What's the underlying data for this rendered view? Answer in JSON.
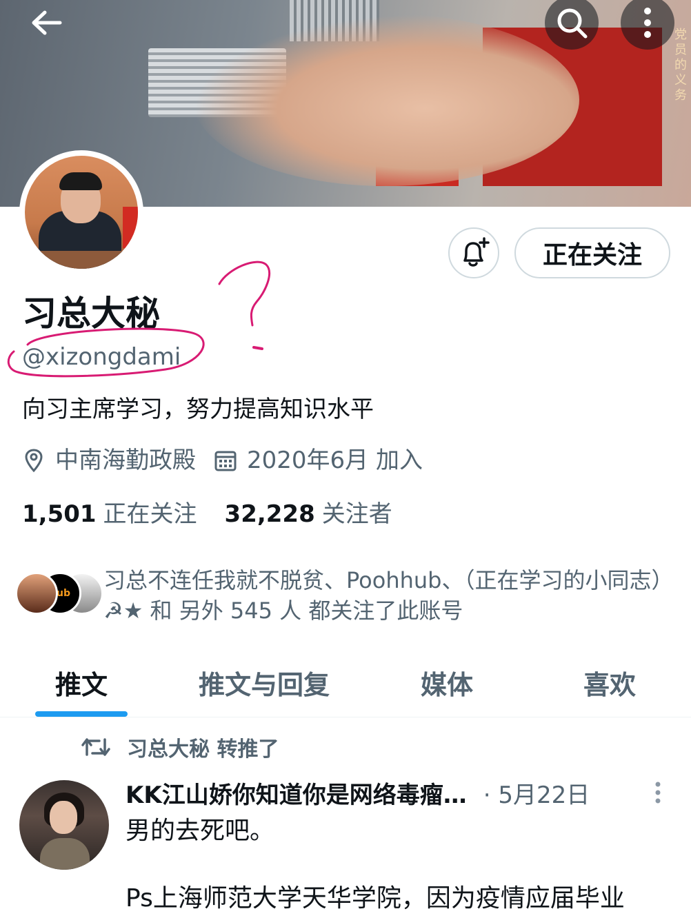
{
  "banner": {
    "side_text": "党员的义务"
  },
  "profile": {
    "display_name": "习总大秘",
    "handle": "@xizongdami",
    "bio": "向习主席学习，努力提高知识水平",
    "location": "中南海勤政殿",
    "joined": "2020年6月 加入",
    "following_count": "1,501",
    "following_label": "正在关注",
    "followers_count": "32,228",
    "followers_label": "关注者"
  },
  "actions": {
    "follow_label": "正在关注"
  },
  "followed_by": {
    "text": "习总不连任我就不脱贫、Poohhub、（正在学习的小同志）☭★ 和 另外 545 人 都关注了此账号",
    "badge": "hub"
  },
  "tabs": [
    {
      "label": "推文",
      "active": true
    },
    {
      "label": "推文与回复",
      "active": false
    },
    {
      "label": "媒体",
      "active": false
    },
    {
      "label": "喜欢",
      "active": false
    }
  ],
  "tweet": {
    "retweeted_by": "习总大秘 转推了",
    "author": "KK江山娇你知道你是网络毒瘤…",
    "date": "· 5月22日",
    "text_line1": "男的去死吧。",
    "text_line2": "Ps上海师范大学天华学院，因为疫情应届毕业"
  },
  "annotation": {
    "mark": "?",
    "color": "#d81b73"
  },
  "colors": {
    "accent": "#1d9bf0",
    "secondary_text": "#536471",
    "primary_text": "#0f1419"
  }
}
